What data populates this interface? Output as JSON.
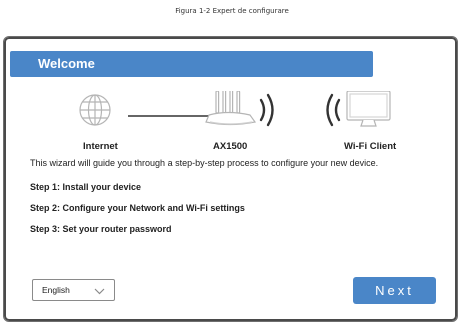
{
  "caption": "Figura 1-2 Expert de configurare",
  "wizard": {
    "title": "Welcome",
    "diagram": {
      "internet_label": "Internet",
      "router_label": "AX1500",
      "client_label": "Wi-Fi Client",
      "icons": [
        "globe-icon",
        "router-icon",
        "wifi-signal-icon",
        "monitor-icon"
      ]
    },
    "intro": "This wizard will guide you through a step-by-step process to configure your new device.",
    "steps": [
      "Step 1: Install your device",
      "Step 2: Configure your Network and Wi-Fi settings",
      "Step 3: Set your router password"
    ],
    "language": {
      "selected": "English"
    },
    "next_label": "Next"
  },
  "colors": {
    "accent": "#4a86c8",
    "frame": "#4a4a4a",
    "icon_stroke": "#b5b5b5",
    "wave": "#333333"
  }
}
